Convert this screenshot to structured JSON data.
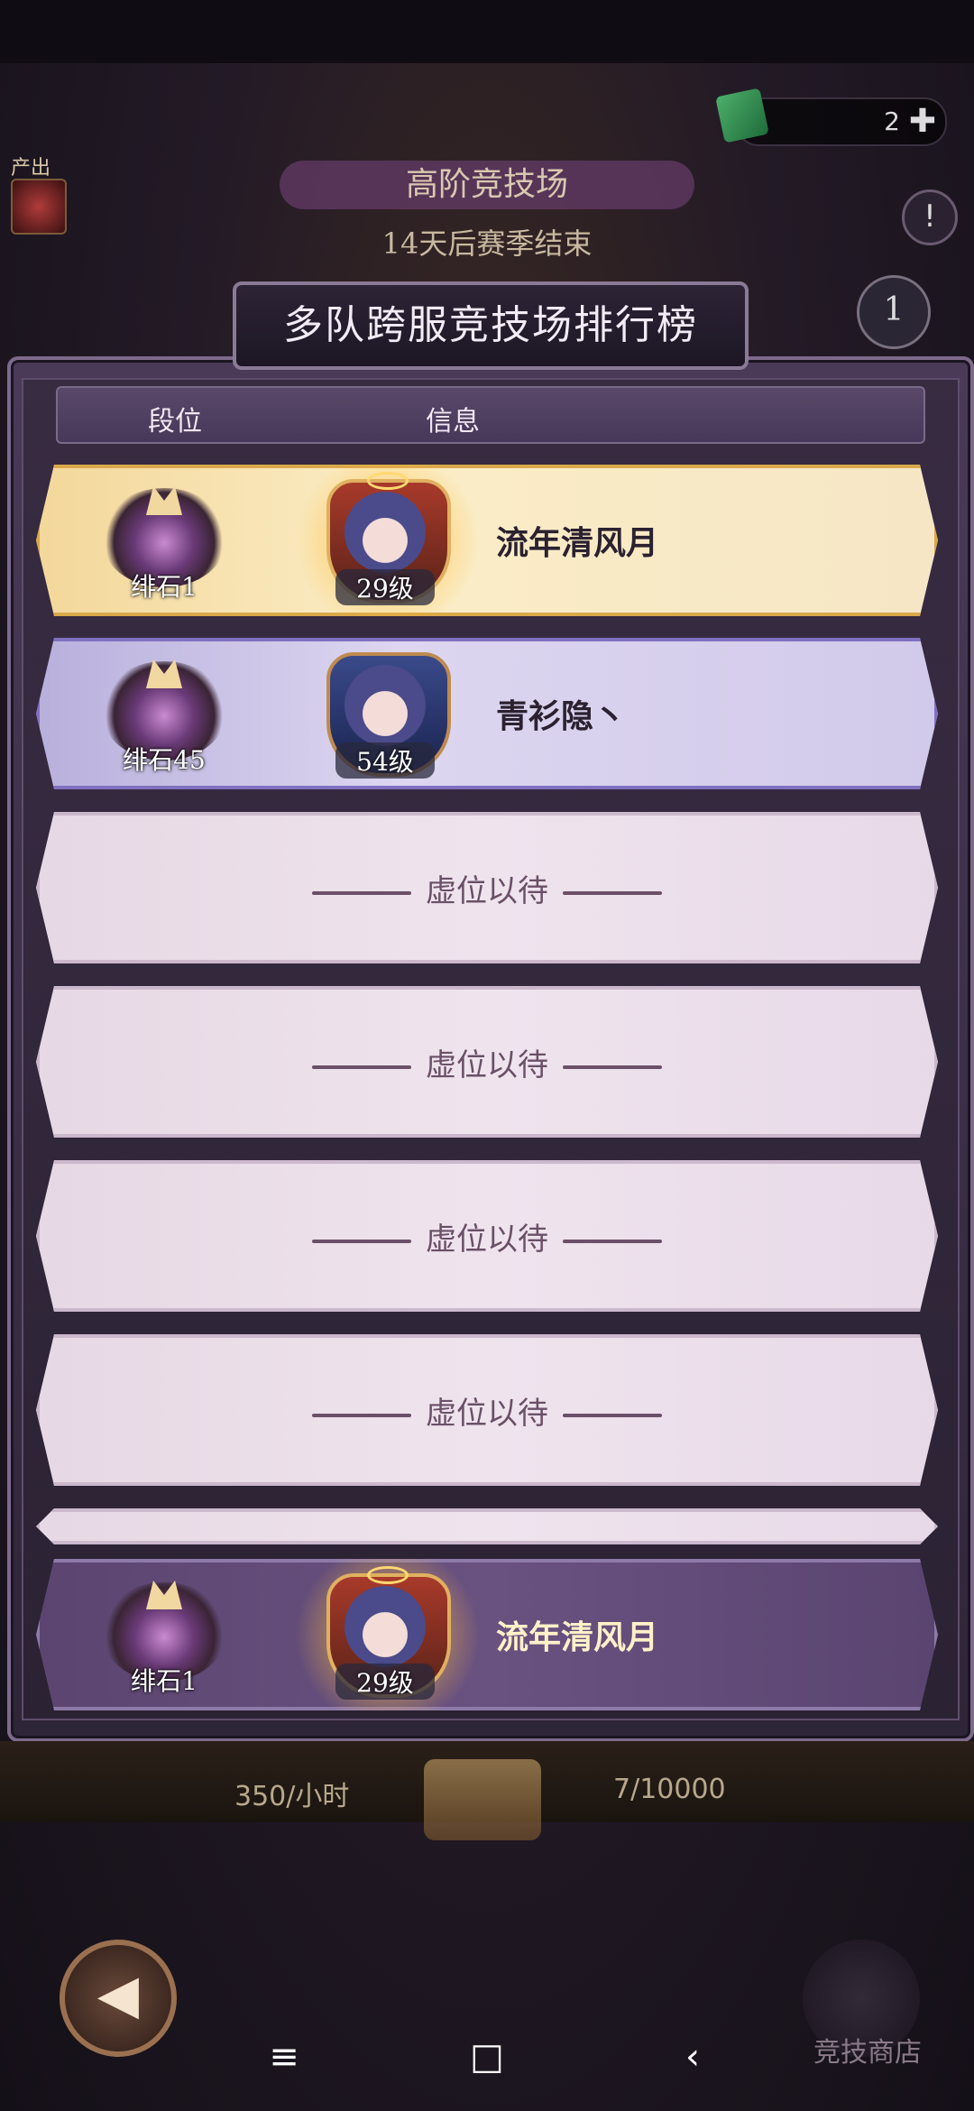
{
  "header": {
    "currency_count": "2",
    "plus_symbol": "✚",
    "output_label": "产出",
    "arena_title": "高阶竞技场",
    "season_text": "14天后赛季结束",
    "info_symbol": "!",
    "rank_badge": "1"
  },
  "modal": {
    "title": "多队跨服竞技场排行榜",
    "columns": {
      "segment": "段位",
      "info": "信息"
    },
    "rows": [
      {
        "rank_label": "绯石1",
        "level": "29级",
        "name": "流年清风月",
        "style": "gold"
      },
      {
        "rank_label": "绯石45",
        "level": "54级",
        "name": "青衫隐丶",
        "style": "violet"
      },
      {
        "placeholder": "虚位以待"
      },
      {
        "placeholder": "虚位以待"
      },
      {
        "placeholder": "虚位以待"
      },
      {
        "placeholder": "虚位以待"
      }
    ],
    "self_row": {
      "rank_label": "绯石1",
      "level": "29级",
      "name": "流年清风月"
    }
  },
  "footer": {
    "speed": "350/小时",
    "capacity": "7/10000",
    "back_symbol": "◀",
    "shop_label": "竞技商店"
  },
  "navbar": {
    "menu_symbol": "≡",
    "home_symbol": "□",
    "back_symbol": "‹"
  }
}
